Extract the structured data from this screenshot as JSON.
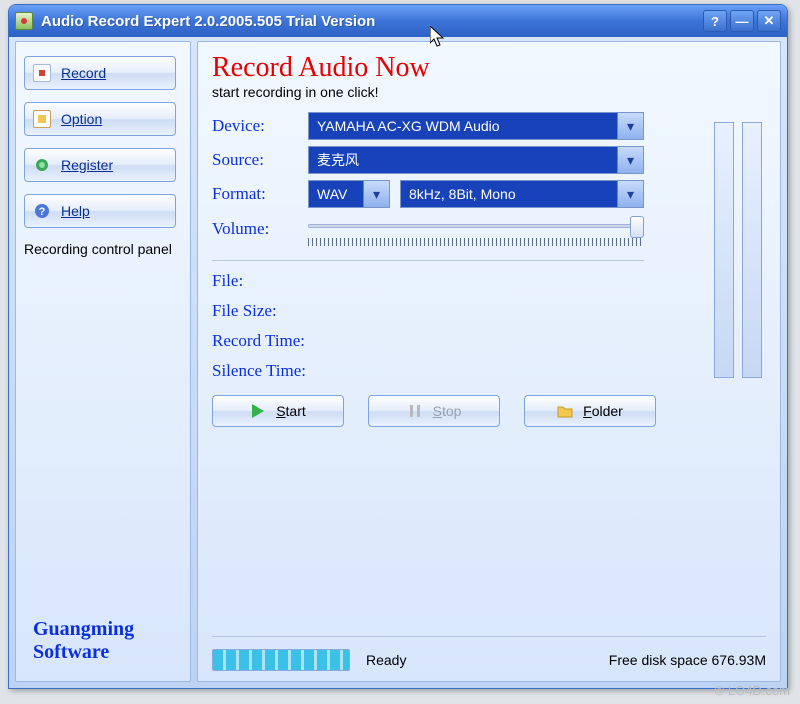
{
  "title": "Audio Record Expert 2.0.2005.505 Trial Version",
  "sidebar": {
    "items": [
      {
        "label": "Record"
      },
      {
        "label": "Option"
      },
      {
        "label": "Register"
      },
      {
        "label": "Help"
      }
    ],
    "caption": "Recording control panel"
  },
  "brand": {
    "line1": "Guangming",
    "line2": "Software"
  },
  "main": {
    "heading": "Record Audio Now",
    "subheading": "start recording in one click!",
    "labels": {
      "device": "Device:",
      "source": "Source:",
      "format": "Format:",
      "volume": "Volume:",
      "file": "File:",
      "filesize": "File Size:",
      "rectime": "Record Time:",
      "siltime": "Silence Time:"
    },
    "device": "YAMAHA AC-XG WDM Audio",
    "source": "麦克风",
    "format_codec": "WAV",
    "format_detail": "8kHz, 8Bit, Mono",
    "buttons": {
      "start": "Start",
      "stop": "Stop",
      "folder": "Folder"
    }
  },
  "status": {
    "ready": "Ready",
    "freespace_label": "Free disk space",
    "freespace_value": "676.93M"
  },
  "watermark": "© LO4D.com"
}
